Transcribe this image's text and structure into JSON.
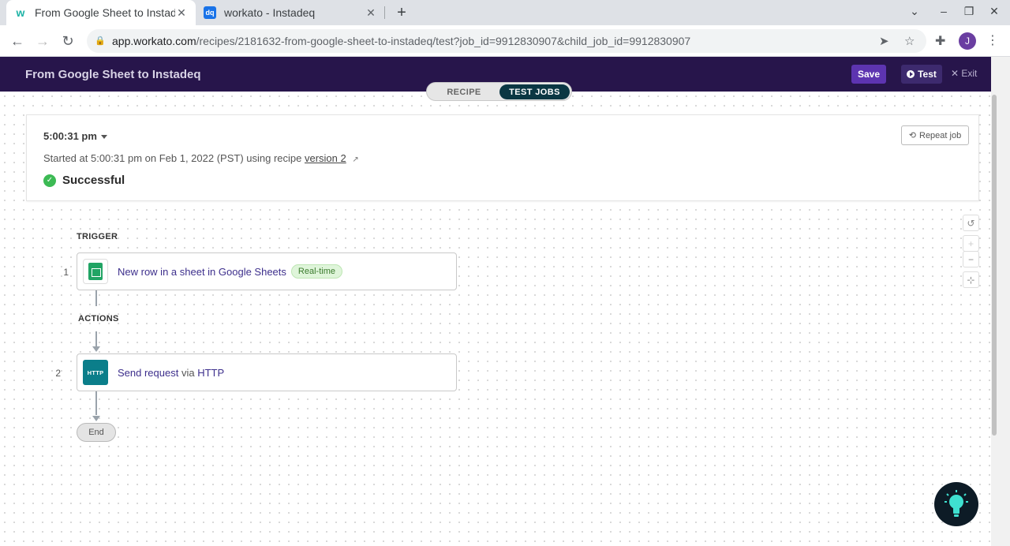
{
  "browser": {
    "tabs": [
      {
        "title": "From Google Sheet to Instadeq",
        "active": true,
        "favicon": "workato-icon"
      },
      {
        "title": "workato - Instadeq",
        "active": false,
        "favicon": "instadeq-icon"
      }
    ],
    "url_host": "app.workato.com",
    "url_path": "/recipes/2181632-from-google-sheet-to-instadeq/test?job_id=9912830907&child_job_id=9912830907",
    "profile_initial": "J"
  },
  "header": {
    "recipe_title": "From Google Sheet to Instadeq",
    "save_label": "Save",
    "test_label": "Test",
    "exit_label": "Exit",
    "toggle": {
      "recipe": "RECIPE",
      "test_jobs": "TEST JOBS",
      "selected": "test_jobs"
    }
  },
  "job": {
    "time": "5:00:31 pm",
    "meta_prefix": "Started at 5:00:31 pm on Feb 1, 2022 (PST) using recipe",
    "version_link": "version 2",
    "status": "Successful",
    "repeat_label": "Repeat job"
  },
  "flow": {
    "trigger_label": "TRIGGER",
    "actions_label": "ACTIONS",
    "steps": [
      {
        "number": "1",
        "text": "New row in a sheet in Google Sheets",
        "badge": "Real-time"
      },
      {
        "number": "2",
        "action": "Send request",
        "via": "via",
        "app": "HTTP",
        "icon_text": "HTTP"
      }
    ],
    "end_label": "End"
  },
  "colors": {
    "appbar": "#27154b",
    "primary": "#5d34b0",
    "toggle_active": "#0a3743",
    "success": "#3cba54",
    "sheets": "#21a464",
    "http": "#0b7e8a"
  }
}
